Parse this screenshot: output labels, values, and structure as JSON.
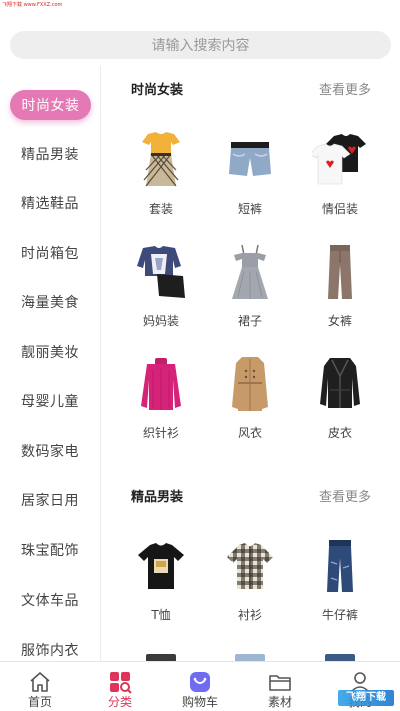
{
  "watermark_top": "飞翔下载 www.FXXZ.com",
  "search": {
    "placeholder": "请输入搜索内容"
  },
  "sidebar": {
    "items": [
      {
        "label": "时尚女装",
        "active": true
      },
      {
        "label": "精品男装"
      },
      {
        "label": "精选鞋品"
      },
      {
        "label": "时尚箱包"
      },
      {
        "label": "海量美食"
      },
      {
        "label": "靓丽美妆"
      },
      {
        "label": "母婴儿童"
      },
      {
        "label": "数码家电"
      },
      {
        "label": "居家日用"
      },
      {
        "label": "珠宝配饰"
      },
      {
        "label": "文体车品"
      },
      {
        "label": "服饰内衣"
      }
    ]
  },
  "sections": [
    {
      "title": "时尚女装",
      "more": "查看更多",
      "items": [
        {
          "label": "套装",
          "icon": "dress-set-icon"
        },
        {
          "label": "短裤",
          "icon": "denim-shorts-icon"
        },
        {
          "label": "情侣装",
          "icon": "couple-tshirt-icon"
        },
        {
          "label": "妈妈装",
          "icon": "mother-outfit-icon"
        },
        {
          "label": "裙子",
          "icon": "gray-dress-icon"
        },
        {
          "label": "女裤",
          "icon": "women-pants-icon"
        },
        {
          "label": "织针衫",
          "icon": "knit-sweater-icon"
        },
        {
          "label": "风衣",
          "icon": "trench-coat-icon"
        },
        {
          "label": "皮衣",
          "icon": "leather-jacket-icon"
        }
      ]
    },
    {
      "title": "精品男装",
      "more": "查看更多",
      "items": [
        {
          "label": "T恤",
          "icon": "black-tshirt-icon"
        },
        {
          "label": "衬衫",
          "icon": "plaid-shirt-icon"
        },
        {
          "label": "牛仔裤",
          "icon": "jeans-icon"
        }
      ]
    }
  ],
  "tabbar": {
    "tabs": [
      {
        "label": "首页",
        "icon": "home-icon"
      },
      {
        "label": "分类",
        "icon": "category-icon",
        "active": true
      },
      {
        "label": "购物车",
        "icon": "cart-icon"
      },
      {
        "label": "素材",
        "icon": "folder-icon"
      },
      {
        "label": "我的",
        "icon": "user-icon"
      }
    ]
  },
  "watermark_br": "飞翔下载",
  "colors": {
    "accent": "#e479b6",
    "tab_active": "#e0355a",
    "search_bg": "#eeeeee"
  }
}
